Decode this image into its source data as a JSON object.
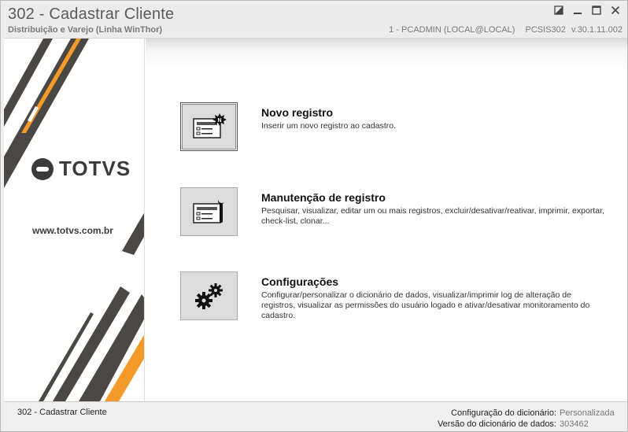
{
  "window": {
    "title": "302 - Cadastrar Cliente",
    "subtitle": "Distribuição e Varejo (Linha WinThor)",
    "user": "1 - PCADMIN (LOCAL@LOCAL)",
    "program": "PCSIS302",
    "version": "v.30.1.11.002",
    "controls": [
      "restore-icon",
      "minimize-icon",
      "maximize-icon",
      "close-icon"
    ]
  },
  "banner": {
    "logo_text": "TOTVS",
    "website": "www.totvs.com.br",
    "colors": {
      "dark": "#4a4745",
      "orange": "#f39a2b"
    }
  },
  "actions": [
    {
      "title": "Novo registro",
      "description": "Inserir um novo registro ao cadastro.",
      "icon": "new-record-icon"
    },
    {
      "title": "Manutenção de registro",
      "description": "Pesquisar, visualizar, editar um ou mais registros, excluir/desativar/reativar, imprimir, exportar, check-list,  clonar...",
      "icon": "maintenance-icon"
    },
    {
      "title": "Configurações",
      "description": "Configurar/personalizar o dicionário de dados, visualizar/imprimir log de alteração de registros, visualizar as permissões do usuário logado e ativar/desativar monitoramento do cadastro.",
      "icon": "gears-icon"
    }
  ],
  "status": {
    "left": "302 - Cadastrar Cliente",
    "dict_config_label": "Configuração do dicionário:",
    "dict_config_value": "Personalizada",
    "dict_version_label": "Versão do dicionário de dados:",
    "dict_version_value": "303462"
  }
}
